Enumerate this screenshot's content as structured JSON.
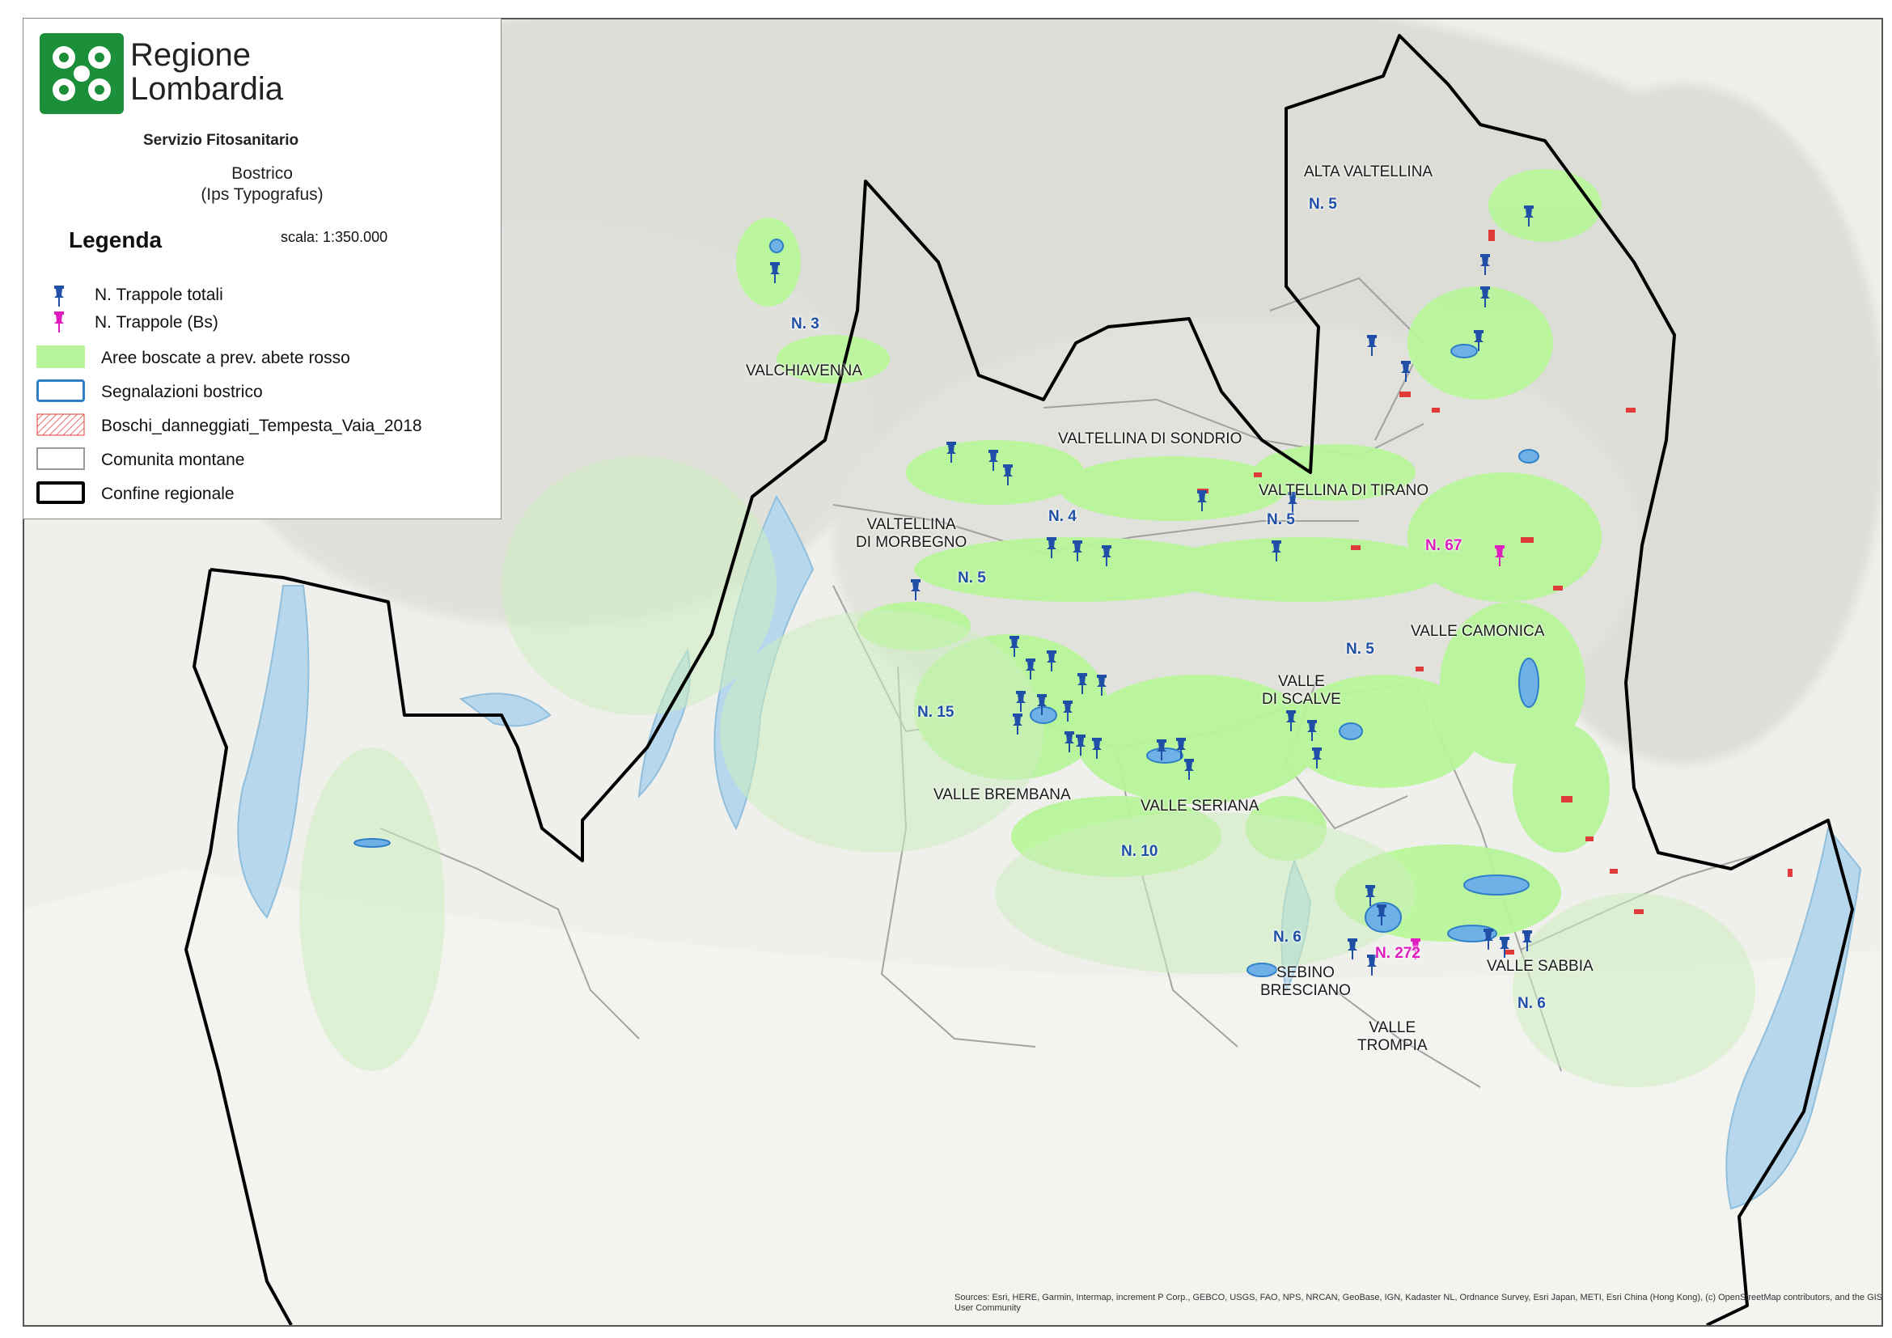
{
  "header": {
    "org_line1": "Regione",
    "org_line2": "Lombardia",
    "department": "Servizio Fitosanitario"
  },
  "map_title": {
    "line1": "Bostrico",
    "line2": "(Ips Typografus)"
  },
  "legend": {
    "heading": "Legenda",
    "scale": "scala: 1:350.000",
    "items": [
      {
        "label": "N. Trappole totali",
        "symbol": "pin-blue-icon",
        "color": "#1f4fa6"
      },
      {
        "label": "N. Trappole (Bs)",
        "symbol": "pin-magenta-icon",
        "color": "#e01ec0"
      },
      {
        "label": "Aree boscate a prev. abete rosso",
        "symbol": "green-fill",
        "color": "#b8f59a"
      },
      {
        "label": "Segnalazioni bostrico",
        "symbol": "blue-outline",
        "color": "#2f7fc8"
      },
      {
        "label": "Boschi_danneggiati_Tempesta_Vaia_2018",
        "symbol": "red-hatch",
        "color": "#e03b3b"
      },
      {
        "label": "Comunita montane",
        "symbol": "gray-outline",
        "color": "#9a9a9a"
      },
      {
        "label": "Confine regionale",
        "symbol": "black-outline",
        "color": "#000000"
      }
    ]
  },
  "regions": [
    {
      "id": "alta-valtellina",
      "line1": "ALTA VALTELLINA",
      "line2": ""
    },
    {
      "id": "valchiavenna",
      "line1": "VALCHIAVENNA",
      "line2": ""
    },
    {
      "id": "valtellina-sondrio",
      "line1": "VALTELLINA DI SONDRIO",
      "line2": ""
    },
    {
      "id": "valtellina-tirano",
      "line1": "VALTELLINA DI TIRANO",
      "line2": ""
    },
    {
      "id": "valtellina-morbegno",
      "line1": "VALTELLINA",
      "line2": "DI MORBEGNO"
    },
    {
      "id": "valle-camonica",
      "line1": "VALLE CAMONICA",
      "line2": ""
    },
    {
      "id": "valle-scalve",
      "line1": "VALLE",
      "line2": "DI SCALVE"
    },
    {
      "id": "valle-brembana",
      "line1": "VALLE BREMBANA",
      "line2": ""
    },
    {
      "id": "valle-seriana",
      "line1": "VALLE SERIANA",
      "line2": ""
    },
    {
      "id": "sebino-bresciano",
      "line1": "SEBINO",
      "line2": "BRESCIANO"
    },
    {
      "id": "valle-sabbia",
      "line1": "VALLE SABBIA",
      "line2": ""
    },
    {
      "id": "valle-trompia",
      "line1": "VALLE",
      "line2": "TROMPIA"
    }
  ],
  "counts": [
    {
      "id": "alta-valtellina",
      "text": "N. 5",
      "type": "totali"
    },
    {
      "id": "valchiavenna",
      "text": "N. 3",
      "type": "totali"
    },
    {
      "id": "valtellina-sondrio",
      "text": "N. 4",
      "type": "totali"
    },
    {
      "id": "valtellina-tirano",
      "text": "N. 5",
      "type": "totali"
    },
    {
      "id": "valtellina-morbegno",
      "text": "N. 5",
      "type": "totali"
    },
    {
      "id": "valle-camonica-bs",
      "text": "N. 67",
      "type": "bs"
    },
    {
      "id": "valle-scalve",
      "text": "N. 5",
      "type": "totali"
    },
    {
      "id": "valle-brembana",
      "text": "N. 15",
      "type": "totali"
    },
    {
      "id": "valle-seriana",
      "text": "N. 10",
      "type": "totali"
    },
    {
      "id": "sebino-bresciano",
      "text": "N. 6",
      "type": "totali"
    },
    {
      "id": "sebino-bs",
      "text": "N. 272",
      "type": "bs"
    },
    {
      "id": "valle-trompia",
      "text": "N. 6",
      "type": "totali"
    }
  ],
  "credits": "Sources: Esri, HERE, Garmin, Intermap, increment P Corp., GEBCO, USGS, FAO, NPS, NRCAN, GeoBase, IGN, Kadaster NL, Ordnance Survey, Esri Japan, METI, Esri China (Hong Kong), (c) OpenStreetMap contributors, and the GIS User Community"
}
